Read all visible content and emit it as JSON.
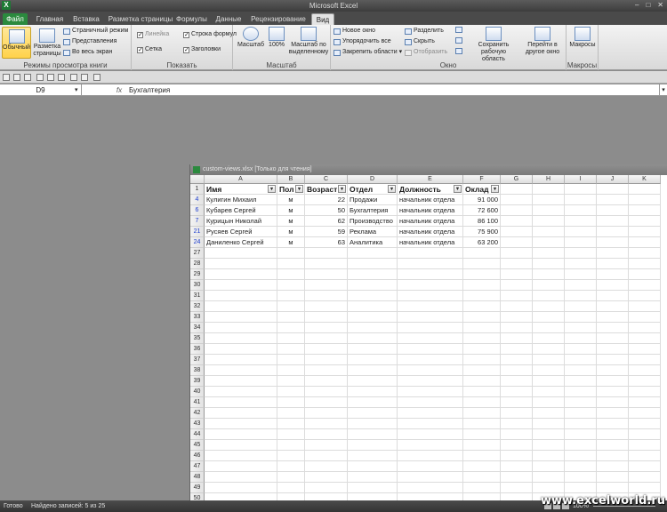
{
  "window": {
    "title": "Microsoft Excel",
    "app_letter": "X",
    "minimize": "–",
    "restore": "□",
    "close": "✕"
  },
  "tabs": [
    {
      "label": "Файл"
    },
    {
      "label": "Главная"
    },
    {
      "label": "Вставка"
    },
    {
      "label": "Разметка страницы"
    },
    {
      "label": "Формулы"
    },
    {
      "label": "Данные"
    },
    {
      "label": "Рецензирование"
    },
    {
      "label": "Вид"
    }
  ],
  "ribbon": {
    "views_group": {
      "label": "Режимы просмотра книги",
      "normal": "Обычный",
      "page_layout_1": "Разметка",
      "page_layout_2": "страницы",
      "page_break": "Страничный режим",
      "custom_views": "Представления",
      "full_screen": "Во весь экран"
    },
    "show_group": {
      "label": "Показать",
      "ruler": "Линейка",
      "gridlines": "Сетка",
      "formula_bar": "Строка формул",
      "headings": "Заголовки"
    },
    "zoom_group": {
      "label": "Масштаб",
      "zoom": "Масштаб",
      "zoom100": "100%",
      "zoom_sel_1": "Масштаб по",
      "zoom_sel_2": "выделенному"
    },
    "window_group": {
      "label": "Окно",
      "new_window": "Новое окно",
      "arrange_all": "Упорядочить все",
      "freeze_panes": "Закрепить области",
      "split": "Разделить",
      "hide": "Скрыть",
      "unhide": "Отобразить",
      "save_ws_1": "Сохранить",
      "save_ws_2": "рабочую область",
      "switch_1": "Перейти в",
      "switch_2": "другое окно"
    },
    "macros_group": {
      "label": "Макросы",
      "macros": "Макросы"
    }
  },
  "formula_bar": {
    "name_box": "D9",
    "fx": "fx",
    "content": "Бухгалтерия"
  },
  "workbook": {
    "title": "custom-views.xlsx  [Только для чтения]"
  },
  "columns": [
    "A",
    "B",
    "C",
    "D",
    "E",
    "F",
    "G",
    "H",
    "I",
    "J",
    "K"
  ],
  "header_row": {
    "row": "1",
    "cells": [
      "Имя",
      "Пол",
      "Возраст",
      "Отдел",
      "Должность",
      "Оклад"
    ]
  },
  "data_rows": [
    {
      "row": "4",
      "cells": [
        "Кулигин Михаил",
        "м",
        "22",
        "Продажи",
        "начальник отдела",
        "91 000"
      ]
    },
    {
      "row": "6",
      "cells": [
        "Кубарев Сергей",
        "м",
        "50",
        "Бухгалтерия",
        "начальник отдела",
        "72 600"
      ]
    },
    {
      "row": "7",
      "cells": [
        "Курицын Николай",
        "м",
        "62",
        "Производство",
        "начальник отдела",
        "86 100"
      ]
    },
    {
      "row": "21",
      "cells": [
        "Русяев Сергей",
        "м",
        "59",
        "Реклама",
        "начальник отдела",
        "75 900"
      ]
    },
    {
      "row": "24",
      "cells": [
        "Даниленко Сергей",
        "м",
        "63",
        "Аналитика",
        "начальник отдела",
        "63 200"
      ]
    }
  ],
  "empty_rows": [
    "27",
    "28",
    "29",
    "30",
    "31",
    "32",
    "33",
    "34",
    "35",
    "36",
    "37",
    "38",
    "39",
    "40",
    "41",
    "42",
    "43",
    "44",
    "45",
    "46",
    "47",
    "48",
    "49",
    "50"
  ],
  "status": {
    "ready": "Готово",
    "records": "Найдено записей: 5 из 25",
    "zoom": "100%"
  },
  "watermark": "www.excelworld.ru"
}
